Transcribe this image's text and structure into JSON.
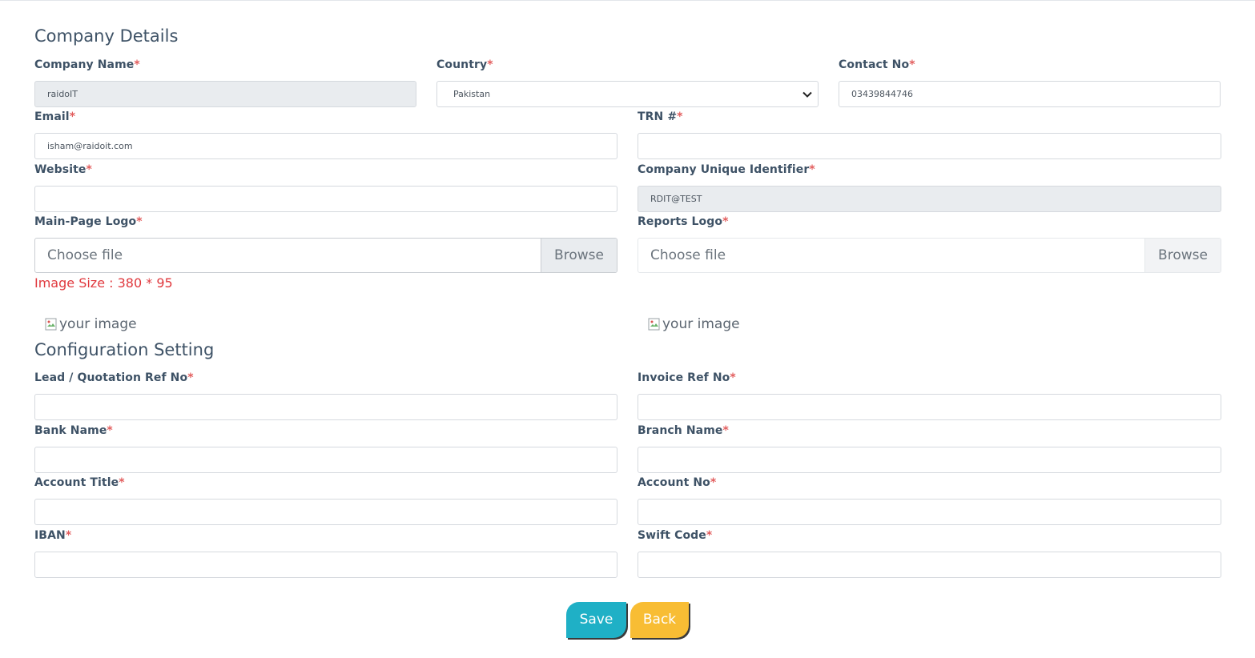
{
  "company_details": {
    "title": "Company Details",
    "company_name": {
      "label": "Company Name",
      "value": "raidoIT"
    },
    "country": {
      "label": "Country",
      "value": "Pakistan"
    },
    "contact_no": {
      "label": "Contact No",
      "value": "03439844746"
    },
    "email": {
      "label": "Email",
      "value": "isham@raidoit.com"
    },
    "trn": {
      "label": "TRN #",
      "value": ""
    },
    "website": {
      "label": "Website",
      "value": ""
    },
    "unique_identifier": {
      "label": "Company Unique Identifier",
      "value": "RDIT@TEST"
    },
    "main_logo": {
      "label": "Main-Page Logo",
      "placeholder": "Choose file",
      "browse": "Browse",
      "hint": "Image Size : 380 * 95",
      "image_alt": "your image"
    },
    "reports_logo": {
      "label": "Reports Logo",
      "placeholder": "Choose file",
      "browse": "Browse",
      "image_alt": "your image"
    }
  },
  "configuration": {
    "title": "Configuration Setting",
    "lead_ref": {
      "label": "Lead / Quotation Ref No",
      "value": ""
    },
    "invoice_ref": {
      "label": "Invoice Ref No",
      "value": ""
    },
    "bank_name": {
      "label": "Bank Name",
      "value": ""
    },
    "branch_name": {
      "label": "Branch Name",
      "value": ""
    },
    "account_title": {
      "label": "Account Title",
      "value": ""
    },
    "account_no": {
      "label": "Account No",
      "value": ""
    },
    "iban": {
      "label": "IBAN",
      "value": ""
    },
    "swift_code": {
      "label": "Swift Code",
      "value": ""
    }
  },
  "required_marker": "*",
  "actions": {
    "save": "Save",
    "back": "Back"
  },
  "colors": {
    "save": "#1fb0c6",
    "back": "#f8bd34",
    "required": "#e25d5d",
    "hint": "#e0393e"
  }
}
